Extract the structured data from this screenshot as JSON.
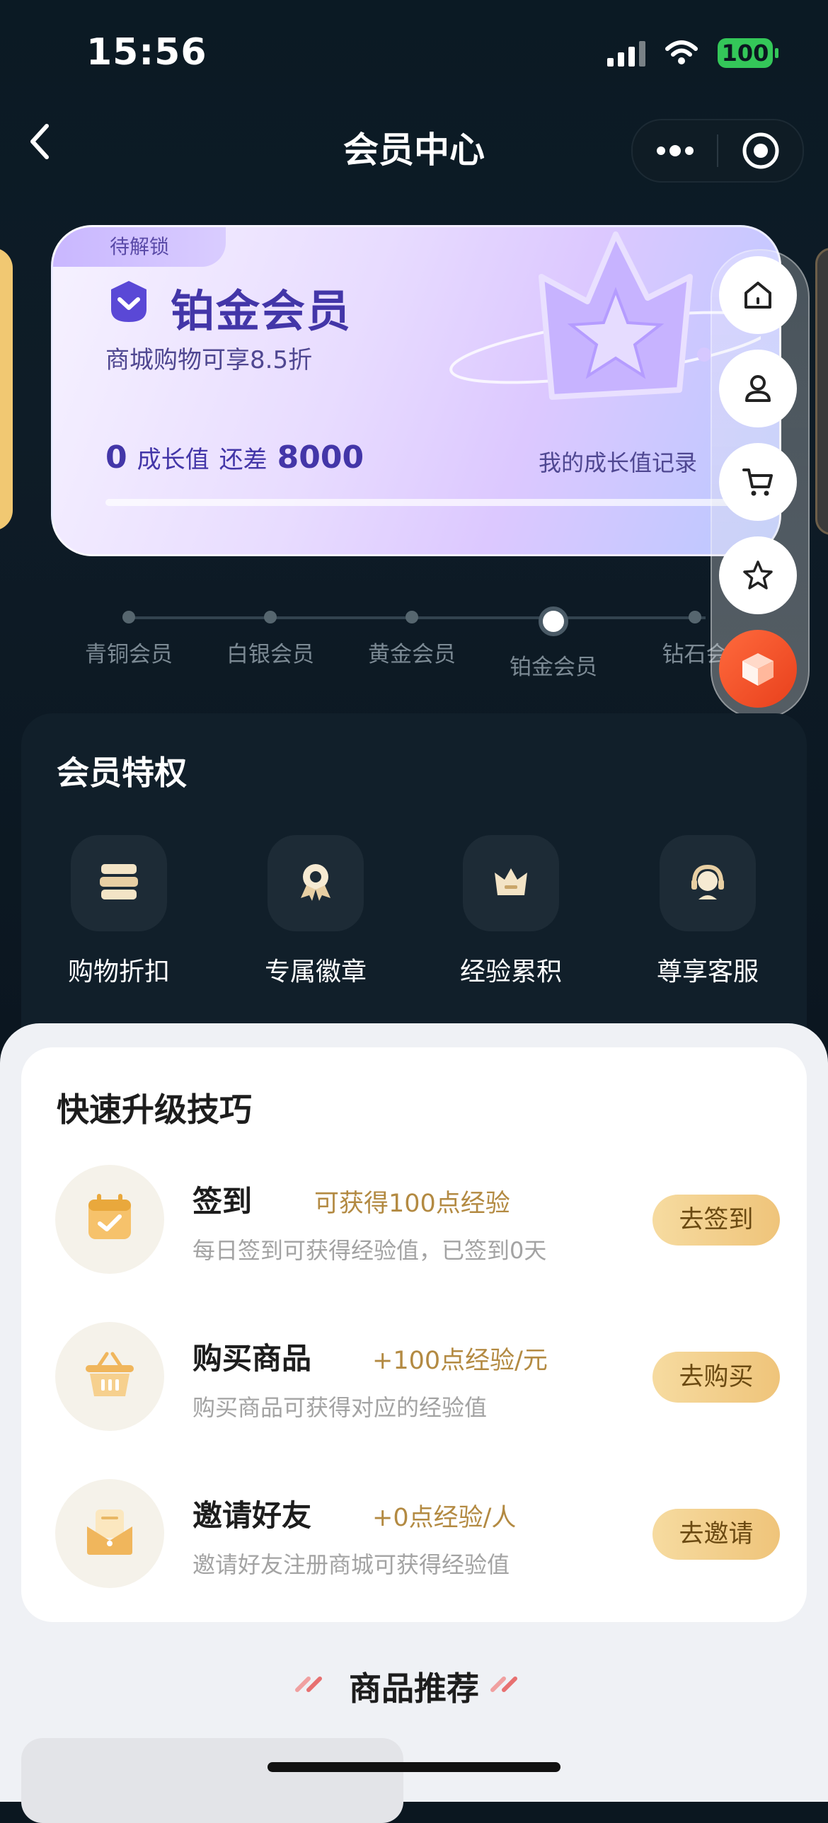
{
  "status_bar": {
    "time": "15:56",
    "battery": "100"
  },
  "nav": {
    "title": "会员中心"
  },
  "member_card": {
    "lock_tag": "待解锁",
    "title": "铂金会员",
    "subtitle": "商城购物可享8.5折",
    "growth_value": "0",
    "growth_label": "成长值",
    "gap_label": "还差",
    "gap_value": "8000",
    "record_link": "我的成长值记录",
    "progress": 0
  },
  "tiers": [
    {
      "name": "青铜会员",
      "active": false
    },
    {
      "name": "白银会员",
      "active": false
    },
    {
      "name": "黄金会员",
      "active": false
    },
    {
      "name": "铂金会员",
      "active": true
    },
    {
      "name": "钻石会",
      "active": false
    }
  ],
  "privileges": {
    "title": "会员特权",
    "items": [
      {
        "label": "购物折扣",
        "icon": "ticket-icon"
      },
      {
        "label": "专属徽章",
        "icon": "medal-icon"
      },
      {
        "label": "经验累积",
        "icon": "crown-icon"
      },
      {
        "label": "尊享客服",
        "icon": "headset-icon"
      }
    ]
  },
  "tips": {
    "title": "快速升级技巧",
    "tasks": [
      {
        "name": "签到",
        "reward": "可获得100点经验",
        "desc": "每日签到可获得经验值，已签到0天",
        "button": "去签到",
        "icon": "calendar-check-icon"
      },
      {
        "name": "购买商品",
        "reward": "+100点经验/元",
        "desc": "购买商品可获得对应的经验值",
        "button": "去购买",
        "icon": "basket-icon"
      },
      {
        "name": "邀请好友",
        "reward": "+0点经验/人",
        "desc": "邀请好友注册商城可获得经验值",
        "button": "去邀请",
        "icon": "envelope-icon"
      }
    ]
  },
  "recommend": {
    "title": "商品推荐"
  },
  "floating_menu": [
    "home-icon",
    "user-icon",
    "cart-icon",
    "star-icon",
    "cube-icon"
  ],
  "colors": {
    "background": "#0b1720",
    "card_title": "#4336a8",
    "gold_button": "#efc47a",
    "reward_text": "#b38a42"
  }
}
